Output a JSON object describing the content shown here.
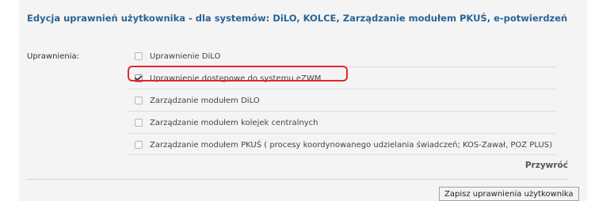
{
  "header": {
    "title": "Edycja uprawnień użytkownika - dla systemów: DiLO, KOLCE, Zarządzanie modułem PKUŚ, e-potwierdzeń"
  },
  "form": {
    "permissions_label": "Uprawnienia:",
    "options": [
      {
        "label": "Uprawnienie DiLO",
        "checked": false
      },
      {
        "label": "Uprawnienie dostępowe do systemu eZWM",
        "checked": true
      },
      {
        "label": "Zarządzanie modułem DiLO",
        "checked": false
      },
      {
        "label": "Zarządzanie modułem kolejek centralnych",
        "checked": false
      },
      {
        "label": "Zarządzanie modułem PKUŚ ( procesy koordynowanego udzielania świadczeń; KOS-Zawał, POZ PLUS)",
        "checked": false
      }
    ],
    "restore_label": "Przywróć",
    "save_label": "Zapisz uprawnienia użytkownika"
  },
  "colors": {
    "title": "#2a6496",
    "highlight": "#e3262c",
    "panel_background": "#f4f4f4"
  }
}
